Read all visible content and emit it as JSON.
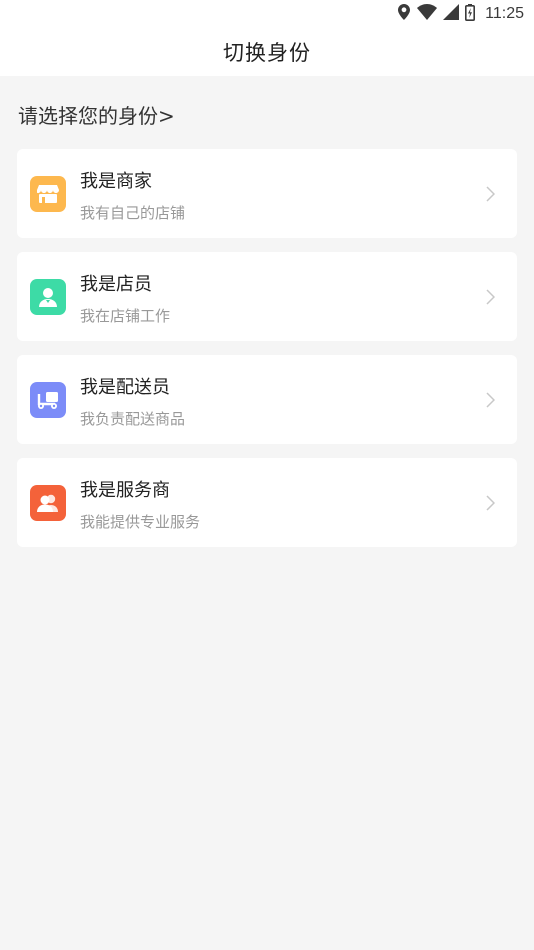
{
  "status_bar": {
    "time": "11:25",
    "icons": [
      "location-icon",
      "wifi-icon",
      "signal-icon",
      "battery-icon"
    ]
  },
  "header": {
    "title": "切换身份"
  },
  "prompt": {
    "text": "请选择您的身份>"
  },
  "roles": [
    {
      "title": "我是商家",
      "subtitle": "我有自己的店铺",
      "icon": "store-icon",
      "color": "#FDB84E"
    },
    {
      "title": "我是店员",
      "subtitle": "我在店铺工作",
      "icon": "clerk-icon",
      "color": "#3DDBA6"
    },
    {
      "title": "我是配送员",
      "subtitle": "我负责配送商品",
      "icon": "delivery-icon",
      "color": "#7C8CF8"
    },
    {
      "title": "我是服务商",
      "subtitle": "我能提供专业服务",
      "icon": "service-provider-icon",
      "color": "#F4623A"
    }
  ],
  "colors": {
    "background": "#f5f5f5",
    "card": "#ffffff",
    "title_text": "#222222",
    "subtitle_text": "#999999"
  }
}
